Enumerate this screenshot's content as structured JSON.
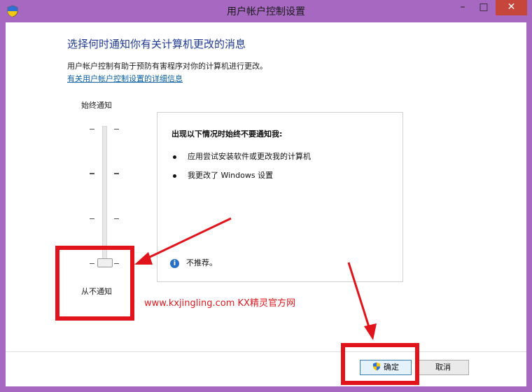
{
  "window": {
    "title": "用户帐户控制设置",
    "minimize_glyph": "–",
    "maximize_glyph": "□",
    "close_glyph": "✕"
  },
  "content": {
    "heading": "选择何时通知你有关计算机更改的消息",
    "description": "用户帐户控制有助于预防有害程序对你的计算机进行更改。",
    "link": "有关用户帐户控制设置的详细信息"
  },
  "slider": {
    "top_label": "始终通知",
    "bottom_label": "从不通知",
    "levels": 4,
    "selected_level": 1
  },
  "panel": {
    "title": "出现以下情况时始终不要通知我:",
    "bullets": [
      "应用尝试安装软件或更改我的计算机",
      "我更改了 Windows 设置"
    ],
    "note": "不推荐。"
  },
  "watermark": "www.kxjingling.com KX精灵官方网",
  "buttons": {
    "ok": "确定",
    "cancel": "取消"
  },
  "colors": {
    "frame": "#a668c1",
    "heading": "#1f3a93",
    "link": "#0b5fa5",
    "annotation": "#e2141b",
    "close_button": "#c7463b"
  },
  "icons": [
    "uac-shield-icon",
    "info-icon",
    "minimize-icon",
    "maximize-icon",
    "close-icon"
  ]
}
